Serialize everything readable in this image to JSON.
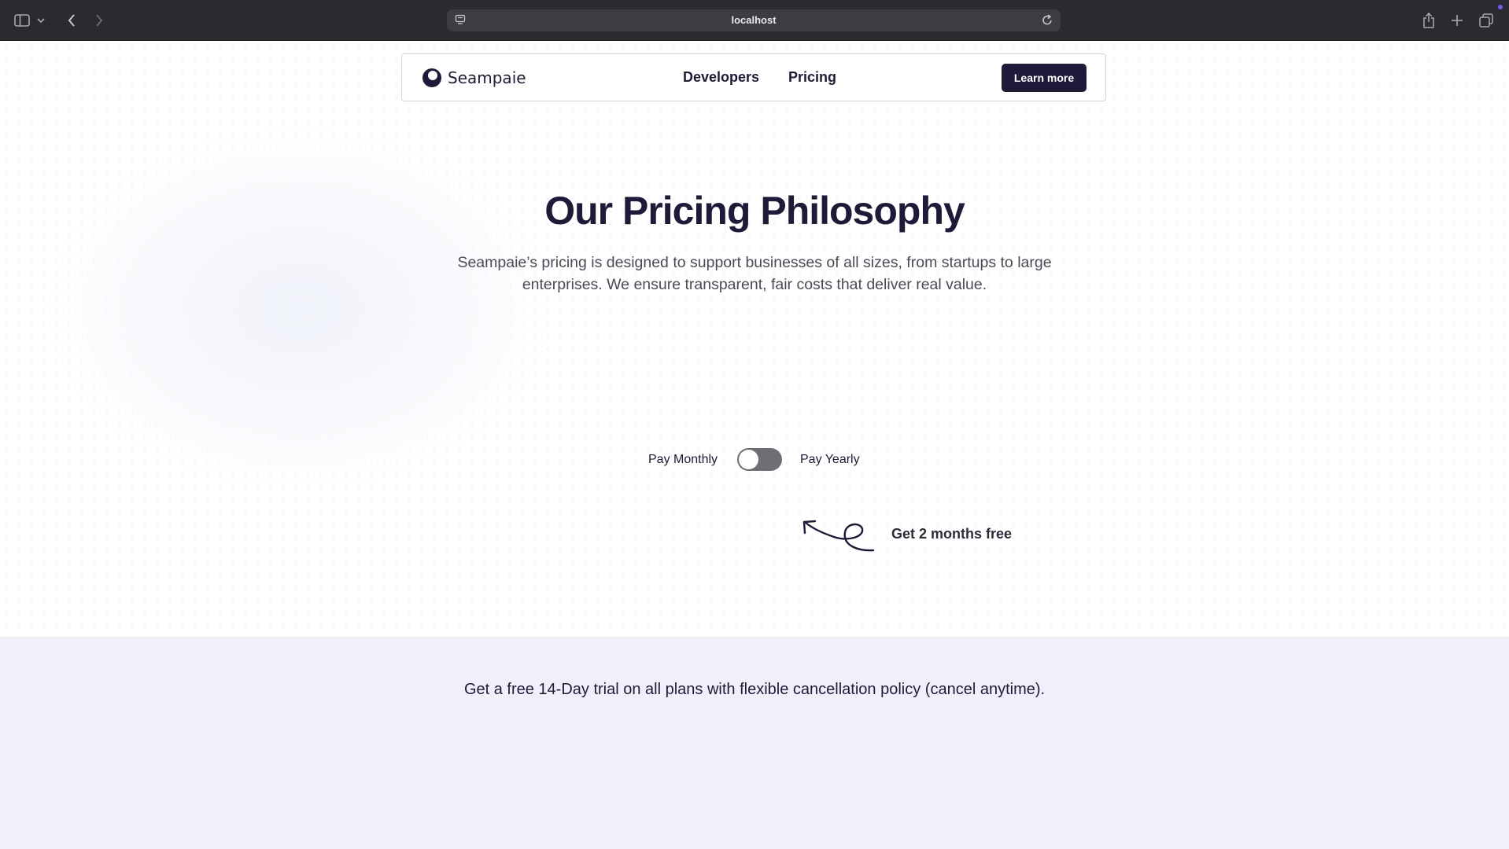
{
  "browser": {
    "url": "localhost",
    "icons": [
      "sidebar-icon",
      "chevron-down-icon",
      "back-icon",
      "forward-icon",
      "site-settings-icon",
      "reload-icon",
      "share-icon",
      "new-tab-icon",
      "tabs-overview-icon"
    ]
  },
  "nav": {
    "brand": "Seampaie",
    "links": [
      "Developers",
      "Pricing"
    ],
    "cta": "Learn more"
  },
  "hero": {
    "title": "Our Pricing Philosophy",
    "subtitle": "Seampaie’s pricing is designed to support businesses of all sizes, from startups to large enterprises. We ensure transparent, fair costs that deliver real value."
  },
  "billing": {
    "monthly_label": "Pay Monthly",
    "yearly_label": "Pay Yearly",
    "yearly_selected": false,
    "promo": "Get 2 months free"
  },
  "trial": {
    "text": "Get a free 14-Day trial on all plans with flexible cancellation policy (cancel anytime)."
  },
  "colors": {
    "brand_dark": "#1e1b3a",
    "chrome_bg": "#2b2a2e",
    "trial_bg": "#f0f0fb",
    "toggle_off": "#6e6e74"
  }
}
